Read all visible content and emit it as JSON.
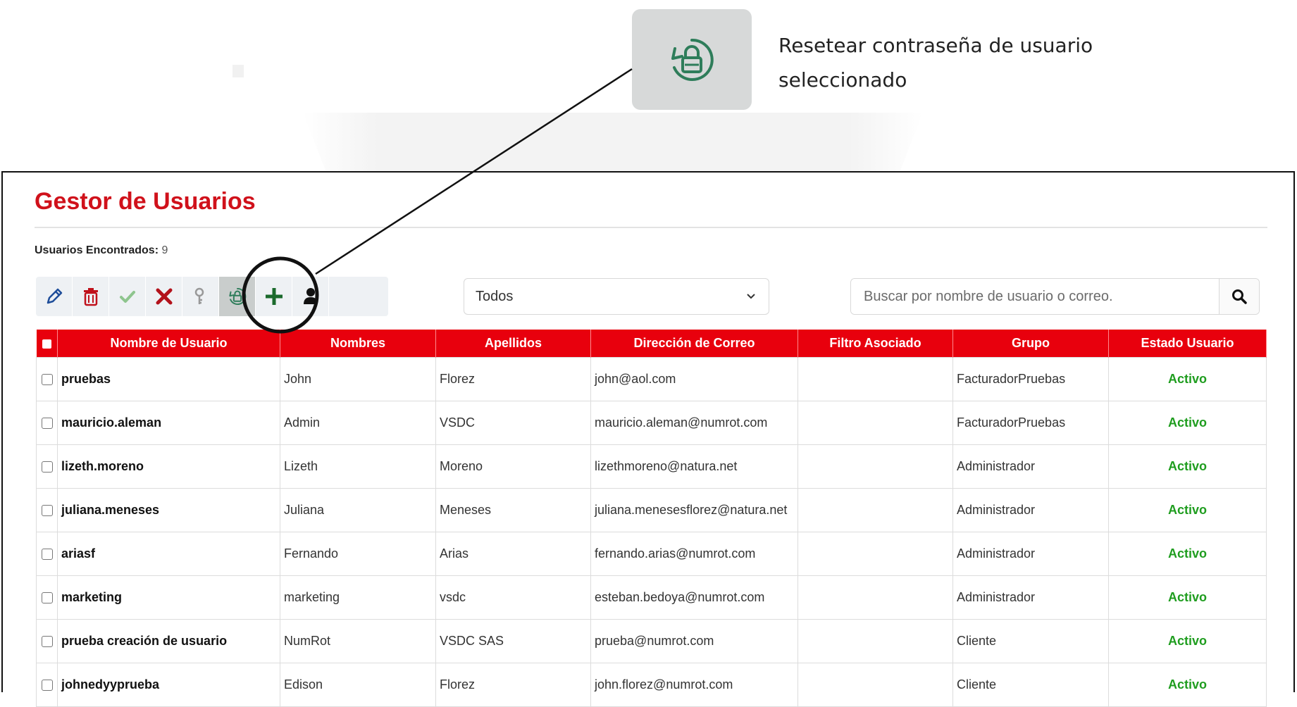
{
  "callout": {
    "text_line1": "Resetear contraseña de usuario",
    "text_line2": "seleccionado",
    "icon": "reset-password-icon"
  },
  "page": {
    "title": "Gestor de Usuarios",
    "count_label": "Usuarios Encontrados:",
    "count_value": "9"
  },
  "toolbar": {
    "buttons": [
      {
        "icon": "pencil-icon",
        "color": "#1f4e9a"
      },
      {
        "icon": "trash-icon",
        "color": "#c0111b"
      },
      {
        "icon": "check-icon",
        "color": "#8ec58e"
      },
      {
        "icon": "close-icon",
        "color": "#b3121b"
      },
      {
        "icon": "key-icon",
        "color": "#999999"
      },
      {
        "icon": "reset-password-icon",
        "color": "#2e7d5a",
        "active": true
      },
      {
        "icon": "plus-icon",
        "color": "#1b6a2c"
      },
      {
        "icon": "user-icon",
        "color": "#111111"
      }
    ]
  },
  "filter": {
    "selected": "Todos"
  },
  "search": {
    "placeholder": "Buscar por nombre de usuario o correo.",
    "icon": "search-icon"
  },
  "table": {
    "headers": [
      "Nombre de Usuario",
      "Nombres",
      "Apellidos",
      "Dirección de Correo",
      "Filtro Asociado",
      "Grupo",
      "Estado Usuario"
    ],
    "rows": [
      {
        "user": "pruebas",
        "nombres": "John",
        "apellidos": "Florez",
        "correo": "john@aol.com",
        "filtro": "",
        "grupo": "FacturadorPruebas",
        "estado": "Activo"
      },
      {
        "user": "mauricio.aleman",
        "nombres": "Admin",
        "apellidos": "VSDC",
        "correo": "mauricio.aleman@numrot.com",
        "filtro": "",
        "grupo": "FacturadorPruebas",
        "estado": "Activo"
      },
      {
        "user": "lizeth.moreno",
        "nombres": "Lizeth",
        "apellidos": "Moreno",
        "correo": "lizethmoreno@natura.net",
        "filtro": "",
        "grupo": "Administrador",
        "estado": "Activo"
      },
      {
        "user": "juliana.meneses",
        "nombres": "Juliana",
        "apellidos": "Meneses",
        "correo": "juliana.menesesflorez@natura.net",
        "filtro": "",
        "grupo": "Administrador",
        "estado": "Activo"
      },
      {
        "user": "ariasf",
        "nombres": "Fernando",
        "apellidos": "Arias",
        "correo": "fernando.arias@numrot.com",
        "filtro": "",
        "grupo": "Administrador",
        "estado": "Activo"
      },
      {
        "user": "marketing",
        "nombres": "marketing",
        "apellidos": "vsdc",
        "correo": "esteban.bedoya@numrot.com",
        "filtro": "",
        "grupo": "Administrador",
        "estado": "Activo"
      },
      {
        "user": "prueba creación de usuario",
        "nombres": "NumRot",
        "apellidos": "VSDC SAS",
        "correo": "prueba@numrot.com",
        "filtro": "",
        "grupo": "Cliente",
        "estado": "Activo"
      },
      {
        "user": "johnedyyprueba",
        "nombres": "Edison",
        "apellidos": "Florez",
        "correo": "john.florez@numrot.com",
        "filtro": "",
        "grupo": "Cliente",
        "estado": "Activo"
      }
    ]
  },
  "colors": {
    "accent_red": "#e8000d",
    "title_red": "#d0111b",
    "active_green": "#1f9d1f"
  }
}
